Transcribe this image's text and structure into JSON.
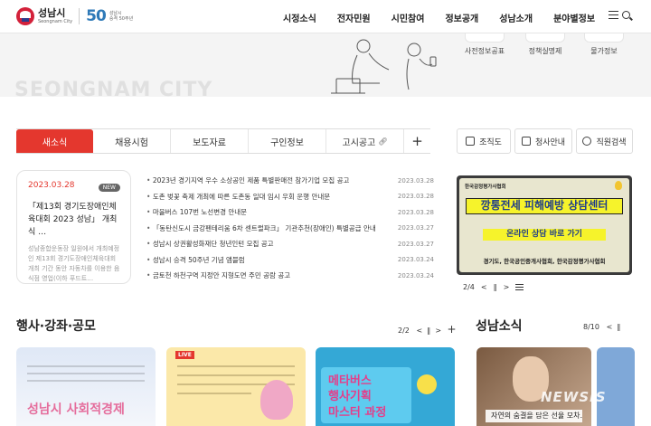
{
  "header": {
    "logo_ko": "성남시",
    "logo_en": "Seongnam City",
    "anniv_number": "50",
    "anniv_sub1": "성남시",
    "anniv_sub2": "승격 50주년",
    "nav": [
      "시정소식",
      "전자민원",
      "시민참여",
      "정보공개",
      "성남소개",
      "분야별정보"
    ]
  },
  "hero": {
    "title": "SEONGNAM CITY",
    "quick_links": [
      "사전정보공표",
      "정책실명제",
      "물가정보"
    ]
  },
  "tabs": {
    "items": [
      "새소식",
      "채용시험",
      "보도자료",
      "구인정보",
      "고시공고"
    ],
    "active": "새소식",
    "more": "+"
  },
  "feature": {
    "date": "2023.03.28",
    "badge": "NEW",
    "title": "「제13회 경기도장애인체육대회 2023 성남」 개최식 …",
    "desc": "성남종합운동장 일원에서 개최예정인 제13회 경기도장애인체육대회 개최 기간 동안 자동차를 이용한 음식점 영업(이하 푸드트…"
  },
  "news": [
    {
      "title": "2023년 경기지역 우수 소상공인 제품 특별판매전 참가기업 모집 공고",
      "date": "2023.03.28"
    },
    {
      "title": "도촌 벚꽃 축제 개최에 따른 도촌동 일대 임시 우회 운행 안내문",
      "date": "2023.03.28"
    },
    {
      "title": "마을버스 107번 노선변경 안내문",
      "date": "2023.03.28"
    },
    {
      "title": "「동탄신도시 금강펜테리움 6차 센트럴파크」 기관추천(장애인) 특별공급 안내",
      "date": "2023.03.27"
    },
    {
      "title": "성남시 상권활성화재단 청년인턴 모집 공고",
      "date": "2023.03.27"
    },
    {
      "title": "성남시 승격 50주년 기념 앰블럼",
      "date": "2023.03.24"
    },
    {
      "title": "금토천 하천구역 지정안 지형도면 주민 공람 공고",
      "date": "2023.03.24"
    }
  ],
  "services": [
    "조직도",
    "청사안내",
    "직원검색"
  ],
  "banner": {
    "org": "한국감정평가사협회",
    "headline": "깡통전세 피해예방 상담센터",
    "sub": "온라인 상담 바로 가기",
    "bottom": "경기도, 한국공인중개사협회, 한국감정평가사협회",
    "pager": "2/4"
  },
  "events": {
    "title": "행사·강좌·공모",
    "pager": "2/2",
    "card1": "성남시 사회적경제",
    "card2": "LIVE",
    "card3_a": "메타버스",
    "card3_b": "행사기획",
    "card3_c": "마스터 과정"
  },
  "seongnam_news": {
    "title": "성남소식",
    "pager": "8/10",
    "caption": "자연의 숨결을 담은 선율 모차…"
  },
  "watermark": "NEWSIS",
  "colors": {
    "accent": "#e4372e",
    "brand_blue": "#2f7ab8",
    "banner_yellow": "#f6f32b"
  }
}
